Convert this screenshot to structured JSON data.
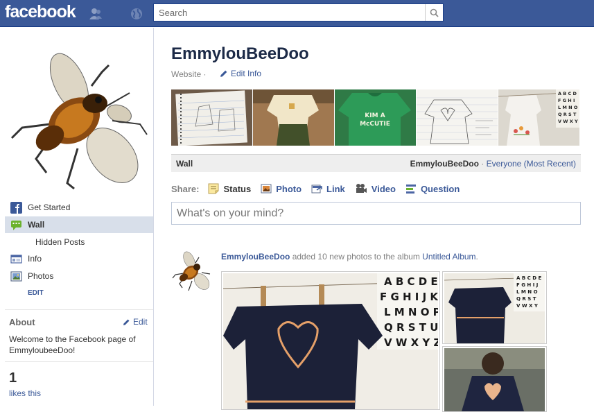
{
  "topbar": {
    "logo": "facebook",
    "search_placeholder": "Search"
  },
  "sidebar": {
    "nav": [
      {
        "label": "Get Started"
      },
      {
        "label": "Wall"
      },
      {
        "label": "Hidden Posts"
      },
      {
        "label": "Info"
      },
      {
        "label": "Photos"
      }
    ],
    "edit_label": "EDIT",
    "about": {
      "title": "About",
      "edit": "Edit",
      "text": "Welcome to the Facebook page of EmmyloubeeDoo!"
    },
    "likes": {
      "count": "1",
      "label": "likes this"
    }
  },
  "page": {
    "title": "EmmylouBeeDoo",
    "category": "Website",
    "category_sep": "·",
    "edit_info": "Edit Info"
  },
  "wall": {
    "label": "Wall",
    "filter_name": "EmmylouBeeDoo",
    "filter_sep": "·",
    "filter_option": "Everyone (Most Recent)"
  },
  "share": {
    "label": "Share:",
    "items": [
      {
        "label": "Status"
      },
      {
        "label": "Photo"
      },
      {
        "label": "Link"
      },
      {
        "label": "Video"
      },
      {
        "label": "Question"
      }
    ],
    "composer_placeholder": "What's on your mind?"
  },
  "story": {
    "actor": "EmmylouBeeDoo",
    "action": " added 10 new photos to the album ",
    "album": "Untitled Album",
    "period": ".",
    "chart_letters": [
      "A B C D E",
      "F G H I J K",
      "L M N O P",
      "Q R S T U",
      "V W X Y Z"
    ]
  },
  "colors": {
    "brand": "#3b5998",
    "selected_nav": "#d8dfea",
    "link": "#3b5998"
  }
}
